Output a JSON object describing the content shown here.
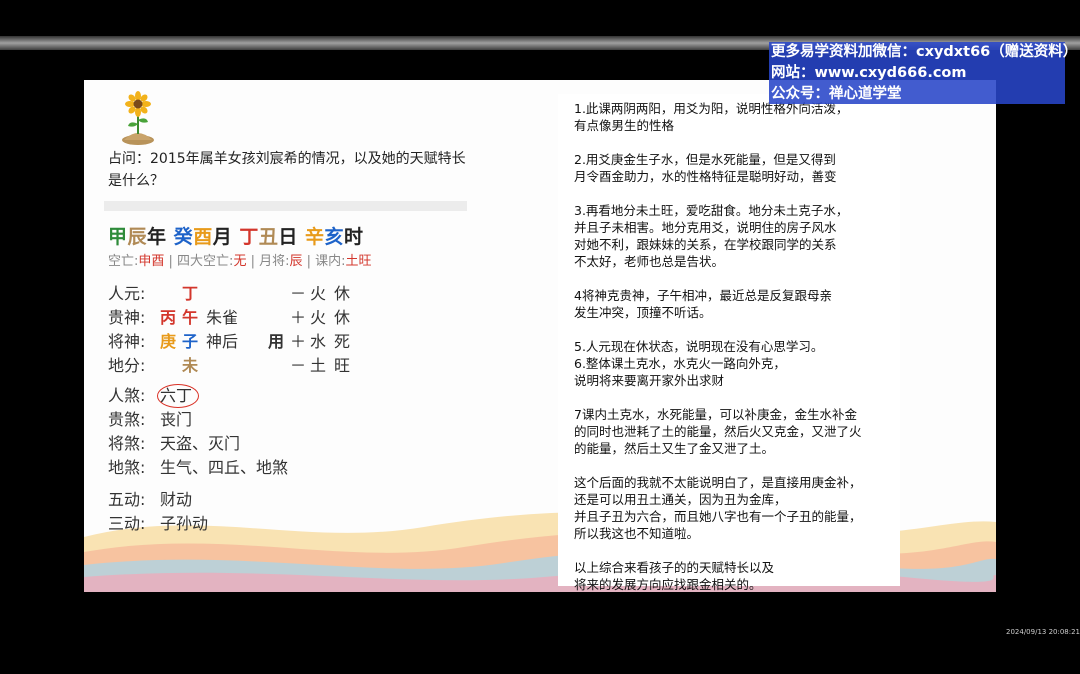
{
  "question": "占问：2015年属羊女孩刘宸希的情况，以及她的天赋特长是什么？",
  "ganzhi": {
    "year_gan": "甲",
    "year_zhi": "辰",
    "year_suffix": "年",
    "month_gan": "癸",
    "month_zhi": "酉",
    "month_suffix": "月",
    "day_gan": "丁",
    "day_zhi": "丑",
    "day_suffix": "日",
    "hour_gan": "辛",
    "hour_zhi": "亥",
    "hour_suffix": "时"
  },
  "kongwang": {
    "kong_label": "空亡:",
    "kong_value": "申酉",
    "sida_label": " | 四大空亡:",
    "sida_value": "无",
    "yuejiang_label": " | 月将:",
    "yuejiang_value": "辰",
    "kenei_label": " | 课内:",
    "kenei_value": "土旺"
  },
  "pan": [
    {
      "label": "人元:",
      "c1": "",
      "c2": "丁",
      "c3": "",
      "c4": "",
      "sign": "－",
      "element": "火",
      "state": "休"
    },
    {
      "label": "贵神:",
      "c1": "丙",
      "c2": "午",
      "c3": "朱雀",
      "c4": "",
      "sign": "＋",
      "element": "火",
      "state": "休"
    },
    {
      "label": "将神:",
      "c1": "庚",
      "c2": "子",
      "c3": "神后",
      "c4": "用",
      "sign": "＋",
      "element": "水",
      "state": "死"
    },
    {
      "label": "地分:",
      "c1": "",
      "c2": "未",
      "c3": "",
      "c4": "",
      "sign": "－",
      "element": "土",
      "state": "旺"
    }
  ],
  "sha": [
    {
      "label": "人煞:",
      "value": "六丁"
    },
    {
      "label": "贵煞:",
      "value": "丧门"
    },
    {
      "label": "将煞:",
      "value": "天盗、灭门"
    },
    {
      "label": "地煞:",
      "value": "生气、四丘、地煞"
    }
  ],
  "dong": [
    {
      "label": "五动:",
      "value": "财动"
    },
    {
      "label": "三动:",
      "value": "子孙动"
    }
  ],
  "analysis": [
    "1.此课两阴两阳，用爻为阳，说明性格外向活泼，\n有点像男生的性格",
    "2.用爻庚金生子水，但是水死能量，但是又得到\n月令酉金助力，水的性格特征是聪明好动，善变",
    "3.再看地分未土旺，爱吃甜食。地分未土克子水，\n并且子未相害。地分克用爻，说明住的房子风水\n对她不利，跟妹妹的关系，在学校跟同学的关系\n不太好，老师也总是告状。",
    "4将神克贵神，子午相冲，最近总是反复跟母亲\n发生冲突，顶撞不听话。",
    "5.人元现在休状态，说明现在没有心思学习。\n6.整体课土克水，水克火一路向外克，\n说明将来要离开家外出求财",
    "7课内土克水，水死能量，可以补庚金，金生水补金\n的同时也泄耗了土的能量，然后火又克金，又泄了火\n的能量，然后土又生了金又泄了土。",
    "这个后面的我就不太能说明白了，是直接用庚金补，\n还是可以用丑土通关，因为丑为金库，\n并且子丑为六合，而且她八字也有一个子丑的能量，\n所以我这也不知道啦。",
    "以上综合来看孩子的的天赋特长以及\n将来的发展方向应找跟金相关的。"
  ],
  "watermark": {
    "line1": "更多易学资料加微信：cxydxt66（赠送资料）",
    "line2": "网站：www.cxyd666.com",
    "line3": "公众号：禅心道学堂"
  },
  "timestamp": "2024/09/13 20:08:21",
  "colors": {
    "wood": "#2e8b3a",
    "water": "#1e63c9",
    "metal": "#e89a1a",
    "fire": "#d3362c",
    "earth": "#b08a55",
    "watermark_bg": "#2846c8"
  }
}
